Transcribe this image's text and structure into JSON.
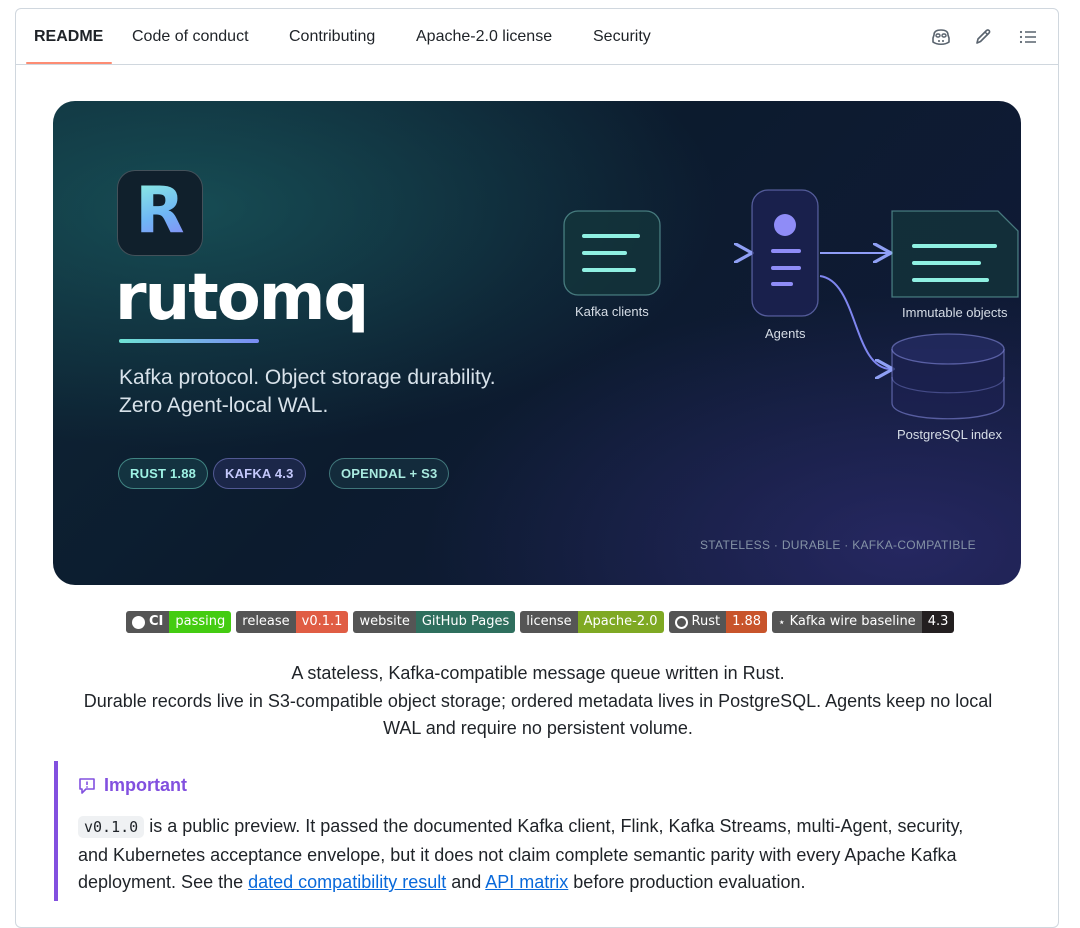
{
  "tabs": [
    {
      "label": "README",
      "active": true
    },
    {
      "label": "Code of conduct"
    },
    {
      "label": "Contributing"
    },
    {
      "label": "Apache-2.0 license"
    },
    {
      "label": "Security"
    }
  ],
  "toolbar": {
    "icons": [
      "copilot-icon",
      "pencil-icon",
      "list-icon"
    ]
  },
  "banner": {
    "logo_letter": "R",
    "brand": "rutomq",
    "tagline_line1": "Kafka protocol. Object storage durability.",
    "tagline_line2": "Zero Agent-local WAL.",
    "pills": [
      "RUST 1.88",
      "KAFKA 4.3",
      "OPENDAL + S3"
    ],
    "diagram": {
      "kafka_clients": "Kafka clients",
      "agents": "Agents",
      "immutable_objects": "Immutable objects",
      "postgres_index": "PostgreSQL index"
    },
    "footer": "STATELESS · DURABLE · KAFKA-COMPATIBLE"
  },
  "badges": [
    {
      "label": "CI",
      "value": "passing",
      "color": "#4c1"
    },
    {
      "label": "release",
      "value": "v0.1.1",
      "color": "#e05d44"
    },
    {
      "label": "website",
      "value": "GitHub Pages",
      "color": "#2f6f5e"
    },
    {
      "label": "license",
      "value": "Apache-2.0",
      "color": "#97ca00"
    },
    {
      "label": "Rust",
      "value": "1.88",
      "color": "#c8542b"
    },
    {
      "label": "Kafka wire baseline",
      "value": "4.3",
      "color": "#231f20"
    }
  ],
  "description": {
    "line1": "A stateless, Kafka-compatible message queue written in Rust.",
    "line2": "Durable records live in S3-compatible object storage; ordered metadata lives in PostgreSQL. Agents keep no local",
    "line3": "WAL and require no persistent volume."
  },
  "alert": {
    "title": "Important",
    "code": "v0.1.0",
    "text1": " is a public preview. It passed the documented Kafka client, Flink, Kafka Streams, multi-Agent, security, and Kubernetes acceptance envelope, but it does not claim complete semantic parity with every Apache Kafka deployment. See the ",
    "link1": "dated compatibility result",
    "text2": " and ",
    "link2": "API matrix",
    "text3": " before production evaluation."
  },
  "colors": {
    "accent": "#8250df",
    "link": "#0969da",
    "tab_underline": "#fd8c73"
  }
}
